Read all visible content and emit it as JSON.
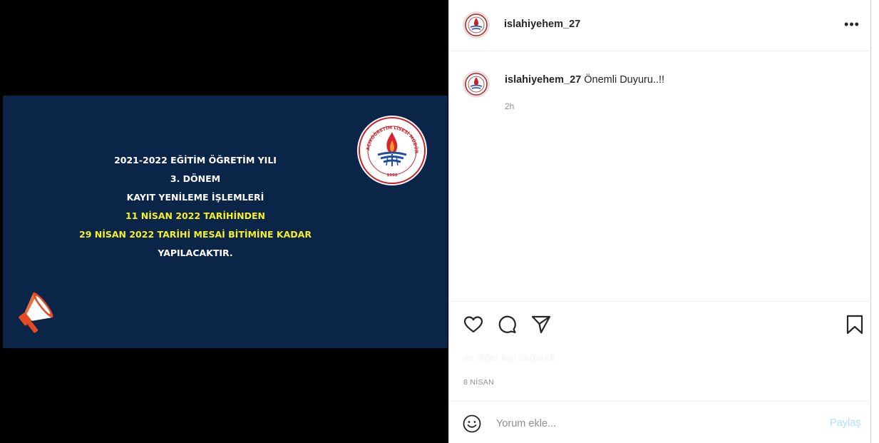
{
  "post": {
    "username": "islahiyehem_27",
    "caption": "Önemli Duyuru..!!",
    "time_ago": "2h",
    "date": "8 NİSAN",
    "likes_text": "ve diğer kişi beğendi"
  },
  "media": {
    "announcement": [
      {
        "text": "2021-2022 EĞİTİM ÖĞRETİM YILI",
        "color": "white"
      },
      {
        "text": "3. DÖNEM",
        "color": "white"
      },
      {
        "text": "KAYIT YENİLEME İŞLEMLERİ",
        "color": "white"
      },
      {
        "text": "11 NİSAN 2022 TARİHİNDEN",
        "color": "yellow"
      },
      {
        "text": "29 NİSAN 2022 TARİHİ MESAİ BİTİMİNE KADAR",
        "color": "yellow"
      },
      {
        "text": "YAPILACAKTIR.",
        "color": "white"
      }
    ],
    "emblem_text": "AÇIKÖĞRETİM LİSESİ MÜDÜRLÜĞÜ",
    "emblem_year": "1992",
    "background_color": "#0b2548",
    "highlight_color": "#f5ef2a"
  },
  "comment": {
    "placeholder": "Yorum ekle...",
    "post_label": "Paylaş"
  },
  "icons": {
    "like": "heart-icon",
    "comment": "comment-icon",
    "share": "paper-plane-icon",
    "save": "bookmark-icon",
    "more": "more-options-icon",
    "emoji": "smiley-icon"
  }
}
